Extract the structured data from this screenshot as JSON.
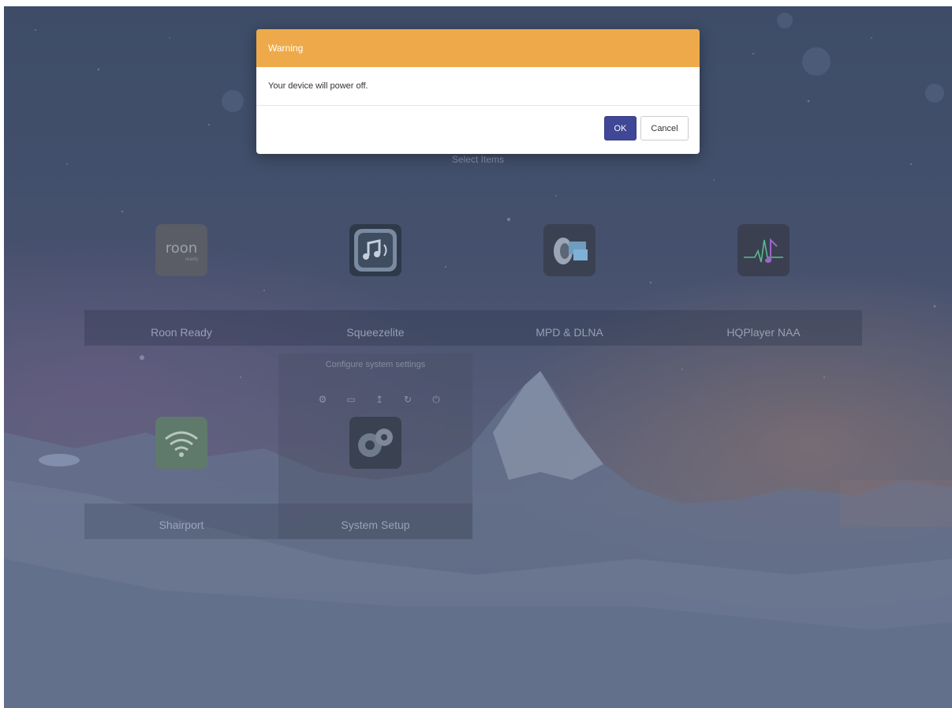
{
  "modal": {
    "title": "Warning",
    "message": "Your device will power off.",
    "ok_label": "OK",
    "cancel_label": "Cancel",
    "header_color": "#eeaa4a",
    "ok_color": "#3f4796"
  },
  "background": {
    "top_text": "Select Items",
    "tiles": [
      {
        "label": "Roon Ready",
        "icon": "roon-ready-icon"
      },
      {
        "label": "Squeezelite",
        "icon": "music-note-icon"
      },
      {
        "label": "MPD & DLNA",
        "icon": "speaker-screen-icon"
      },
      {
        "label": "HQPlayer NAA",
        "icon": "waveform-note-icon"
      },
      {
        "label": "Shairport",
        "icon": "wifi-icon"
      },
      {
        "label": "System Setup",
        "icon": "gears-icon"
      }
    ],
    "roon_logo_text": "roon",
    "roon_logo_subtext": "ready",
    "system_setup_description": "Configure system settings",
    "system_actions": [
      "settings-icon",
      "folder-icon",
      "upload-icon",
      "refresh-icon",
      "power-icon"
    ]
  }
}
